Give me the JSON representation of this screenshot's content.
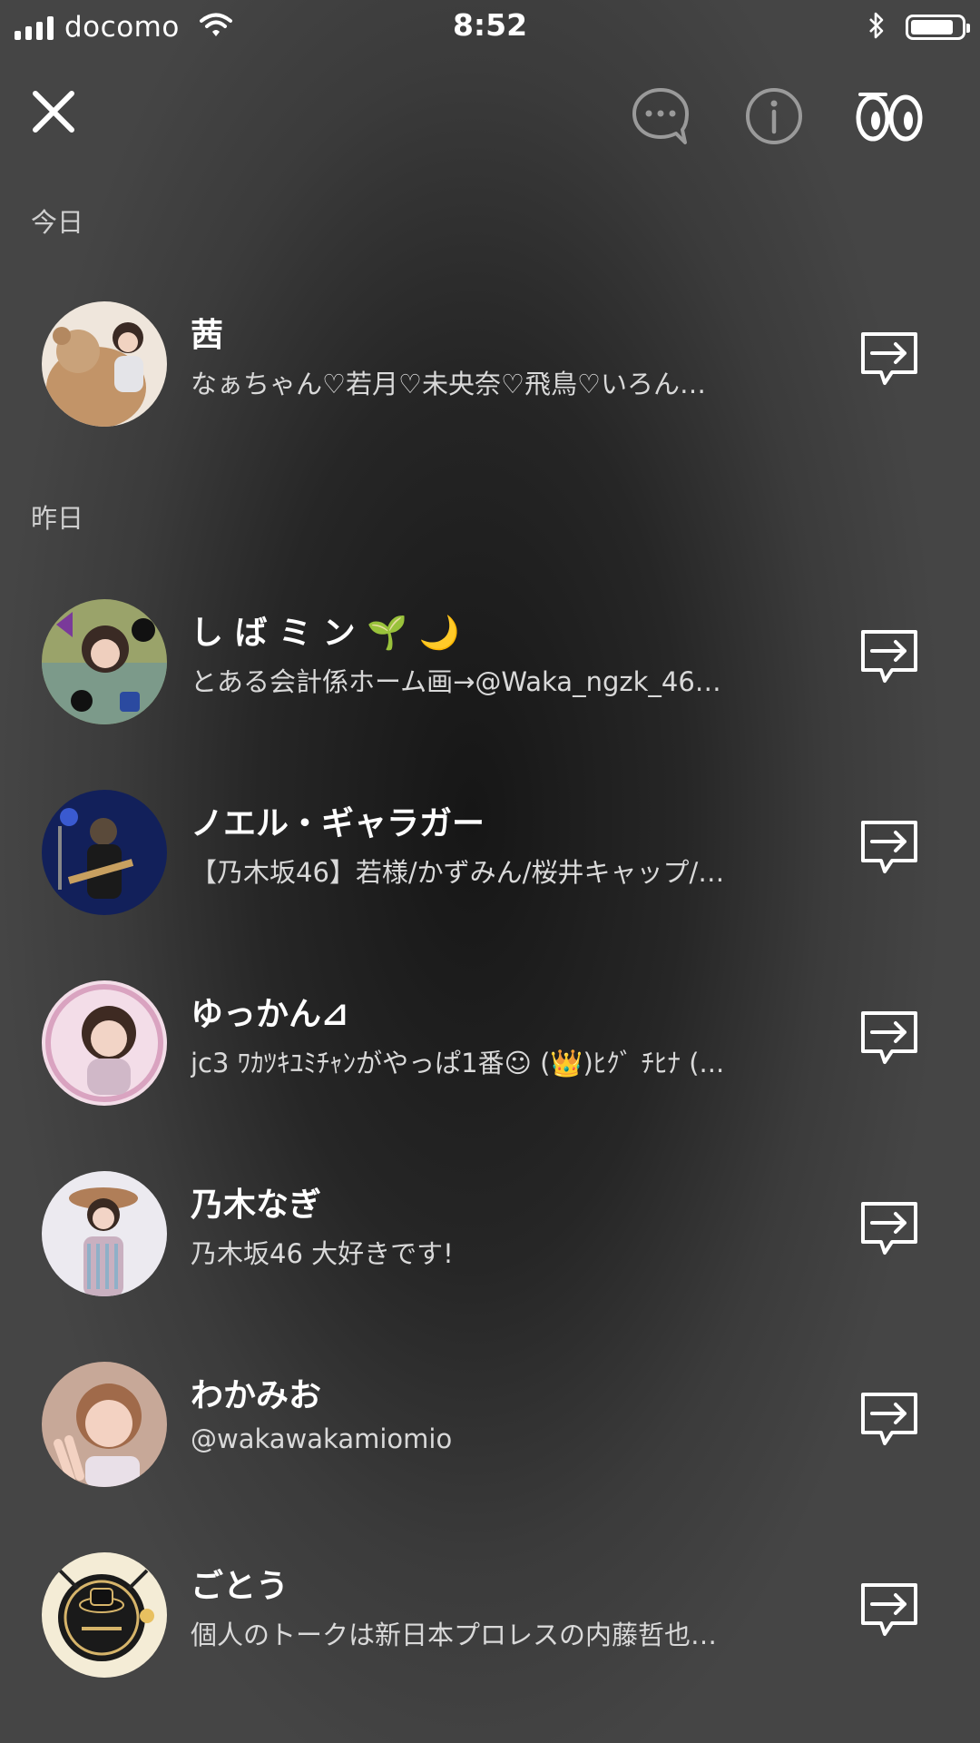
{
  "status_bar": {
    "carrier": "docomo",
    "time": "8:52",
    "battery_level": 0.85
  },
  "toolbar": {
    "close_icon": "close-icon",
    "chat_icon": "chat-bubble-icon",
    "info_icon": "info-icon",
    "watch_icon": "eyes-icon"
  },
  "sections": {
    "today": "今日",
    "yesterday": "昨日"
  },
  "friends": [
    {
      "name": "茜",
      "status": "なぁちゃん♡若月♡未央奈♡飛鳥♡いろん…",
      "avatar_color": "#c9a27a",
      "section": "today"
    },
    {
      "name": "し ば ミ ン 🌱 🌙",
      "status": "とある会計係ホーム画→@Waka_ngzk_46…",
      "avatar_color": "#7a8a55",
      "section": "yesterday"
    },
    {
      "name": "ノエル・ギャラガー",
      "status": "【乃木坂46】若様/かずみん/桜井キャップ/…",
      "avatar_color": "#1a2f7a",
      "section": "yesterday"
    },
    {
      "name": "ゆっかん⊿",
      "status": "jc3 ﾜｶﾂｷﾕﾐﾁｬﾝがやっぱ1番☺ (👑)ﾋｸﾞ ﾁﾋﾅ (...",
      "avatar_color": "#e7c4d8",
      "section": "yesterday"
    },
    {
      "name": "乃木なぎ",
      "status": "乃木坂46  大好きです!",
      "avatar_color": "#d8d6dc",
      "section": "yesterday"
    },
    {
      "name": "わかみお",
      "status": "@wakawakamiomio",
      "avatar_color": "#d9a996",
      "section": "yesterday"
    },
    {
      "name": "ごとう",
      "status": "個人のトークは新日本プロレスの内藤哲也…",
      "avatar_color": "#e9d8a6",
      "section": "yesterday"
    }
  ]
}
